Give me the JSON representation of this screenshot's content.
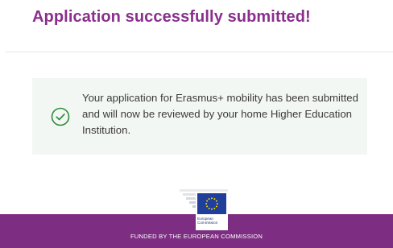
{
  "page_title": "Application successfully submitted!",
  "success_message": {
    "text": "Your application for Erasmus+ mobility has been submitted and will now be reviewed by your home Higher Education Institution.",
    "icon": "check-circle-icon"
  },
  "footer": {
    "logo": {
      "lines": [
        "European",
        "Commission"
      ],
      "icon": "european-commission-logo"
    },
    "funded_text": "FUNDED BY THE EUROPEAN COMMISSION"
  },
  "colors": {
    "accent": "#8a2f8e",
    "success_green": "#2e8b3b",
    "success_bg": "#f3f7f3",
    "footer_bg": "#7d2d82",
    "eu_blue": "#1f3f9a",
    "eu_star": "#f5d400"
  }
}
